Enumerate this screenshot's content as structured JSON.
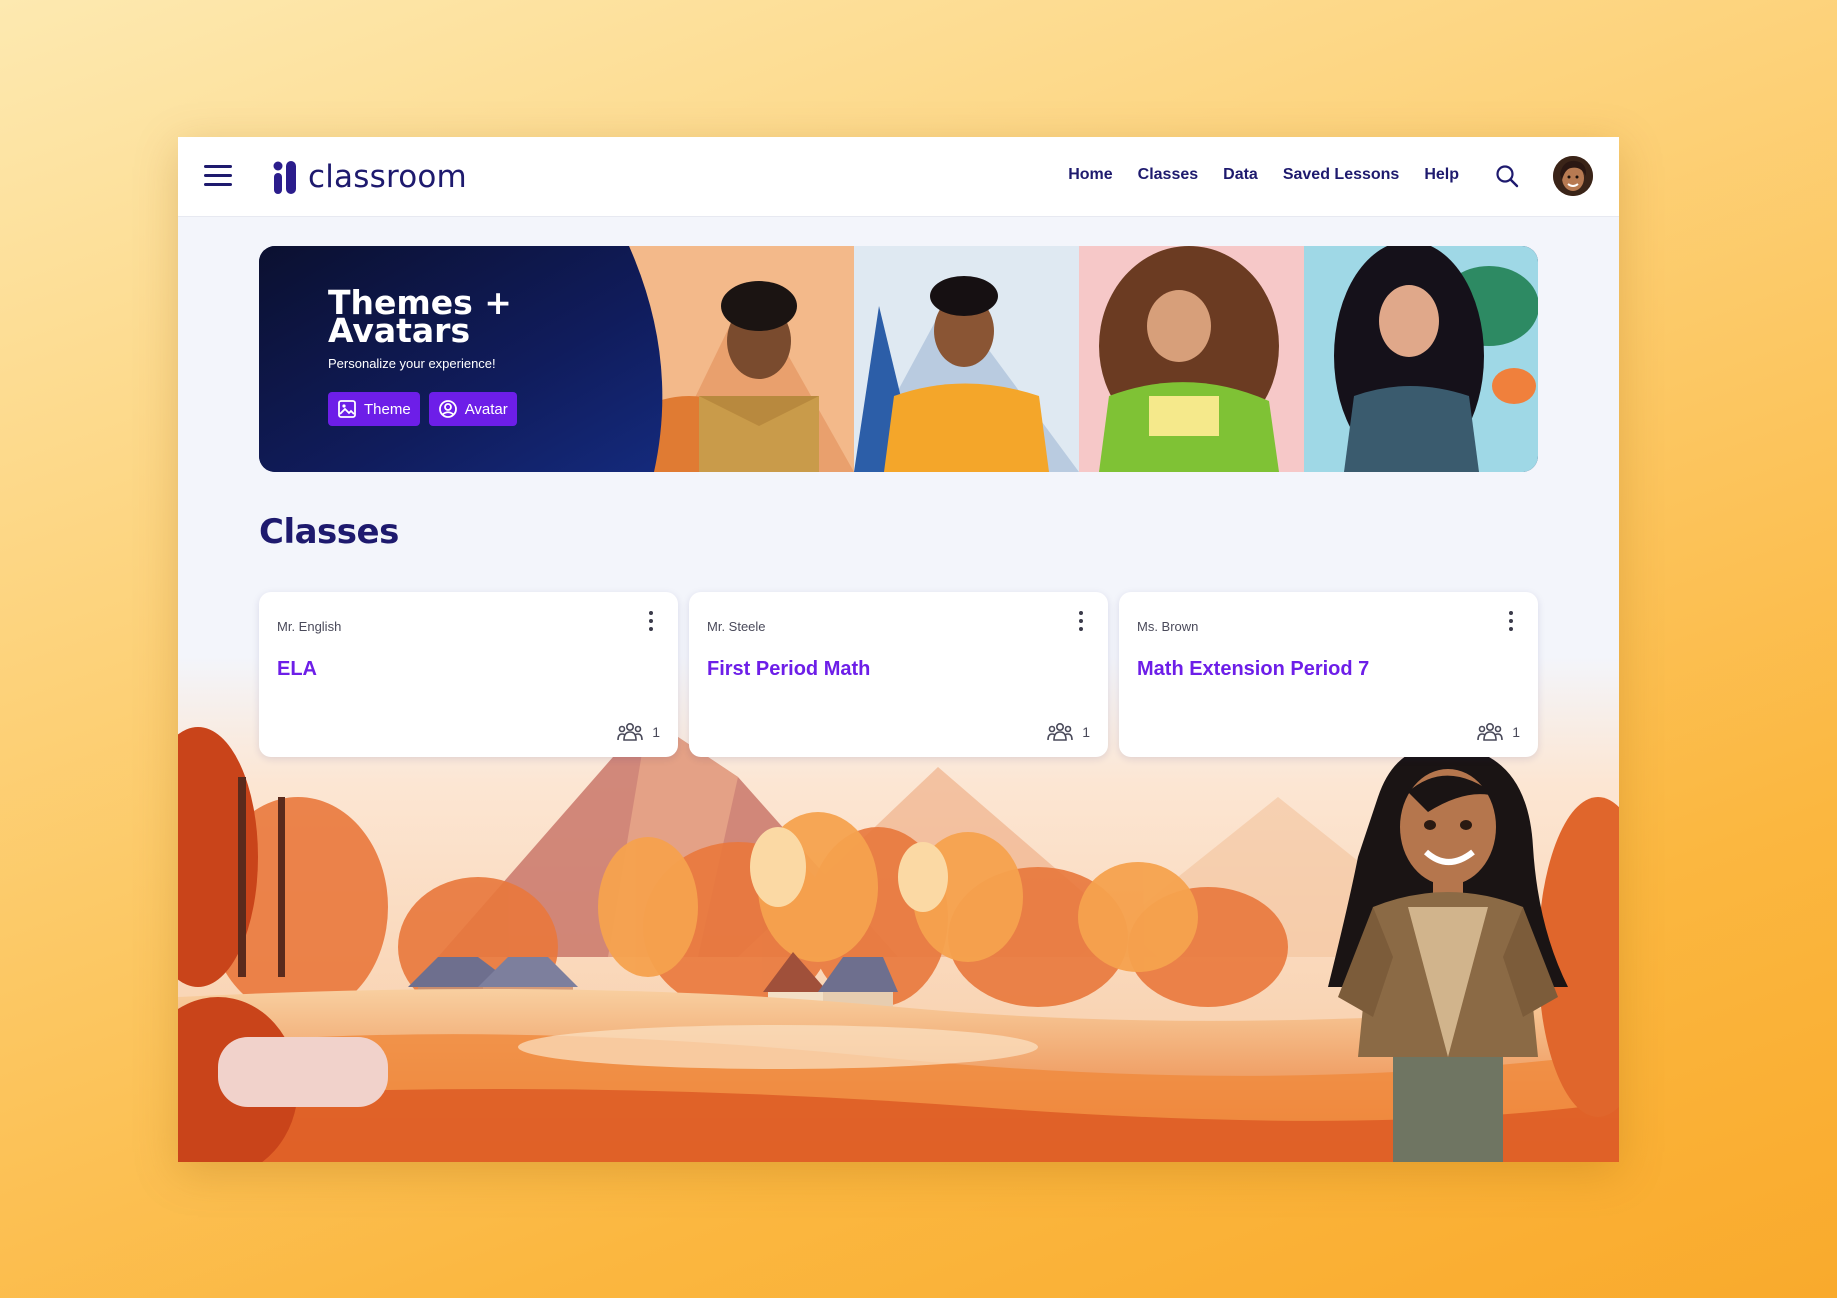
{
  "app": {
    "logo_text": "classroom"
  },
  "nav": {
    "items": [
      "Home",
      "Classes",
      "Data",
      "Saved Lessons",
      "Help"
    ]
  },
  "banner": {
    "title_line1": "Themes +",
    "title_line2": "Avatars",
    "subtitle": "Personalize your experience!",
    "theme_label": "Theme",
    "avatar_label": "Avatar"
  },
  "page": {
    "title": "Classes"
  },
  "classes": [
    {
      "teacher": "Mr. English",
      "name": "ELA",
      "students": "1"
    },
    {
      "teacher": "Mr. Steele",
      "name": "First Period Math",
      "students": "1"
    },
    {
      "teacher": "Ms. Brown",
      "name": "Math Extension Period 7",
      "students": "1"
    }
  ],
  "colors": {
    "accent": "#6d1ee8",
    "navy": "#1e1a6e",
    "page_bg": "#f3f5fb",
    "outer_bg": "#fbb740"
  },
  "icons": {
    "menu": "hamburger-icon",
    "search": "search-icon",
    "theme": "image-icon",
    "avatar": "user-circle-icon",
    "students": "people-group-icon",
    "more": "more-vertical-icon"
  }
}
